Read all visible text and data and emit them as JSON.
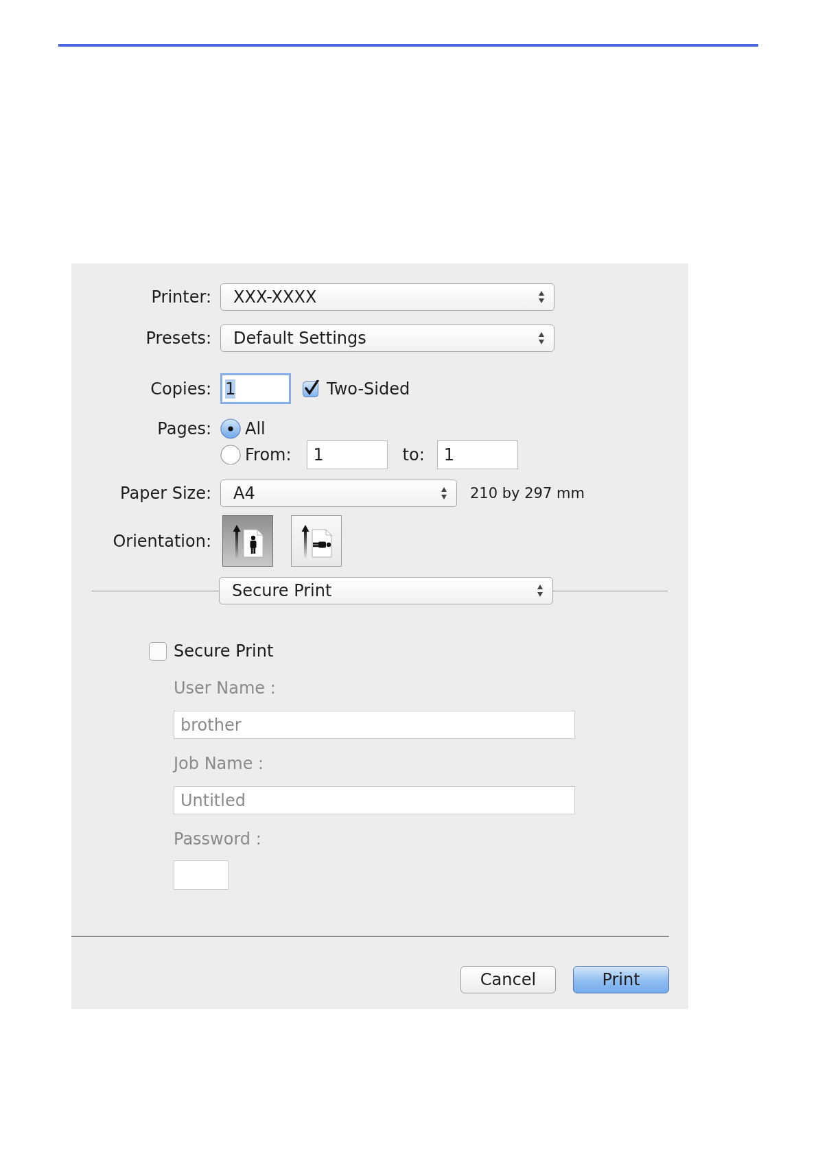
{
  "dialog": {
    "printer": {
      "label": "Printer:",
      "value": "XXX-XXXX"
    },
    "presets": {
      "label": "Presets:",
      "value": "Default Settings"
    },
    "copies": {
      "label": "Copies:",
      "value": "1",
      "focused": true
    },
    "two_sided": {
      "label": "Two-Sided",
      "checked": true
    },
    "pages": {
      "label": "Pages:",
      "options": [
        {
          "kind": "all",
          "label": "All",
          "selected": true
        },
        {
          "kind": "range",
          "label": "From:",
          "selected": false,
          "from": "1",
          "to_label": "to:",
          "to": "1"
        }
      ]
    },
    "paper_size": {
      "label": "Paper Size:",
      "value": "A4",
      "dimensions": "210 by 297 mm"
    },
    "orientation": {
      "label": "Orientation:",
      "options": [
        {
          "kind": "portrait",
          "selected": true
        },
        {
          "kind": "landscape",
          "selected": false
        }
      ]
    },
    "panel_menu": {
      "value": "Secure Print"
    },
    "secure_print": {
      "label": "Secure Print",
      "checked": false,
      "fields": [
        {
          "kind": "text",
          "label": "User Name :",
          "value": "brother",
          "disabled": true
        },
        {
          "kind": "text",
          "label": "Job Name :",
          "value": "Untitled",
          "disabled": true
        },
        {
          "kind": "password",
          "label": "Password :",
          "disabled": true
        }
      ]
    },
    "buttons": [
      {
        "label": "Cancel",
        "default": false
      },
      {
        "label": "Print",
        "default": true
      }
    ]
  }
}
